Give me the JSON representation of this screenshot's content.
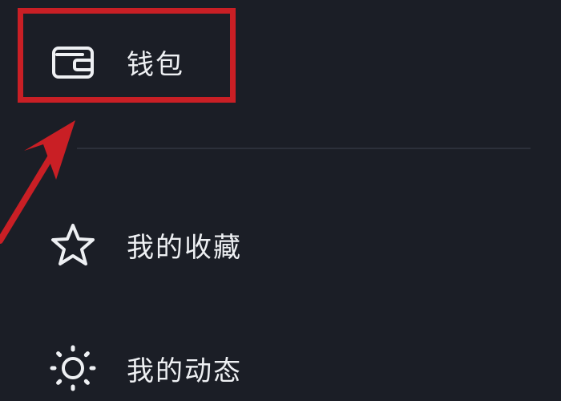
{
  "menu": {
    "items": [
      {
        "icon": "wallet-icon",
        "label": "钱包"
      },
      {
        "icon": "star-icon",
        "label": "我的收藏"
      },
      {
        "icon": "sun-icon",
        "label": "我的动态"
      }
    ]
  },
  "annotation": {
    "highlight_color": "#c91f25",
    "arrow_color": "#c91f25"
  }
}
